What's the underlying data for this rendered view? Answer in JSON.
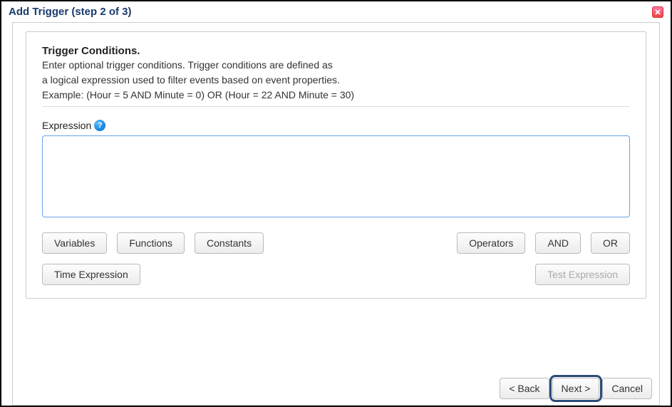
{
  "dialog": {
    "title": "Add Trigger (step 2 of 3)"
  },
  "section": {
    "heading": "Trigger Conditions.",
    "desc_line1": "Enter optional trigger conditions. Trigger conditions are defined as",
    "desc_line2": "a logical expression used to filter events based on event properties.",
    "desc_line3": "Example: (Hour = 5 AND Minute = 0) OR (Hour = 22 AND Minute = 30)"
  },
  "expression": {
    "label": "Expression",
    "help_symbol": "?",
    "value": ""
  },
  "buttons": {
    "variables": "Variables",
    "functions": "Functions",
    "constants": "Constants",
    "operators": "Operators",
    "and": "AND",
    "or": "OR",
    "time_expression": "Time Expression",
    "test_expression": "Test Expression"
  },
  "footer": {
    "back": "< Back",
    "next": "Next >",
    "cancel": "Cancel"
  }
}
